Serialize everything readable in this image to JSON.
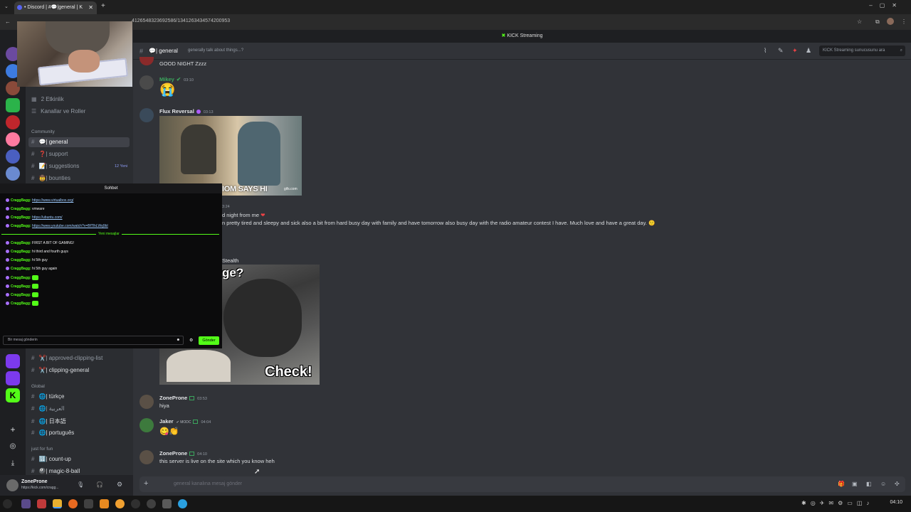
{
  "browser": {
    "tab_title": "• Discord | #💬|general | K",
    "url": "1412654832369258​6/1341263434574200953",
    "url_display": "…41265483236925​86/1341263434574200953"
  },
  "banner": {
    "text": "KICK Streaming"
  },
  "header": {
    "channel": "💬| general",
    "topic": "generally talk about things...?",
    "search_placeholder": "KICK Streaming sunucusunu ara"
  },
  "sidebar": {
    "events": "2 Etkinlik",
    "channels_roles": "Kanallar ve Roller",
    "category_community": "Community",
    "items": [
      {
        "label": "💬| general"
      },
      {
        "label": "❓| support"
      },
      {
        "label": "📝| suggestions",
        "badge": "12 Yeni"
      },
      {
        "label": "🤠| bounties"
      },
      {
        "label": "✂️| approved-clipping-list"
      },
      {
        "label": "✂️| clipping-general"
      }
    ],
    "category_global": "Global",
    "global_items": [
      {
        "label": "🌐| türkçe"
      },
      {
        "label": "🌐| العربية"
      },
      {
        "label": "🌐| 日本語"
      },
      {
        "label": "🌐| português"
      }
    ],
    "category_fun": "just for fun",
    "fun_items": [
      {
        "label": "🔢| count-up"
      },
      {
        "label": "🎱| magic-8-ball"
      }
    ]
  },
  "user_panel": {
    "name": "ZoneProne",
    "status": "https://kick.com/cragg..."
  },
  "overlay": {
    "title": "Sohbet",
    "new_messages": "Yeni mesajlar",
    "input_placeholder": "Bir mesaj gönderin",
    "send_label": "Gönder",
    "lines": [
      {
        "user": "CraggBagg:",
        "text": "https://www.virtualbox.org/",
        "link": true
      },
      {
        "user": "CraggBagg:",
        "text": "vmware",
        "link": false
      },
      {
        "user": "CraggBagg:",
        "text": "https://ubuntu.com/",
        "link": true
      },
      {
        "user": "CraggBagg:",
        "text": "https://www.youtube.com/watch?v=BfTlhLWq9bI",
        "link": true
      },
      {
        "user": "CraggBagg:",
        "text": "FIRST A BIT OF GAMING!",
        "link": false
      },
      {
        "user": "CraggBagg:",
        "text": "hi third and fourth guys",
        "link": false
      },
      {
        "user": "CraggBagg:",
        "text": "hi 5th guy",
        "link": false
      },
      {
        "user": "CraggBagg:",
        "text": "hi 5th guy again",
        "link": false
      },
      {
        "user": "CraggBagg:",
        "text": "",
        "link": false
      },
      {
        "user": "CraggBagg:",
        "text": "",
        "link": false
      },
      {
        "user": "CraggBagg:",
        "text": "",
        "link": false
      },
      {
        "user": "CraggBagg:",
        "text": "",
        "link": false
      }
    ]
  },
  "messages": {
    "m0": {
      "text": "GOOD NIGHT Zzzz"
    },
    "m1": {
      "user": "Mikey",
      "time": "03:10",
      "emoji": "😭"
    },
    "m2": {
      "user": "Flux Reversal",
      "time": "03:13",
      "gif_caption": "TOM SAYS HI",
      "gif_caption_visible": "IOM SAYS HI",
      "gif_source": "gifs.com"
    },
    "m3": {
      "time": "3:24",
      "line1": "d night from me",
      "line2": "n pretty tired and sleepy and sick also a bit from hard busy day with family and have tomorrow also busy day with the radio amateur contest I have. Much love and have a great day."
    },
    "m4": {
      "user": "Stealth",
      "img_top": "ge?",
      "img_bottom": "Check!"
    },
    "m5": {
      "user": "ZoneProne",
      "time": "03:53",
      "text": "hiya"
    },
    "m6": {
      "user": "Jaker",
      "tag": "MODC",
      "time": "04:04",
      "emoji": "😋👏"
    },
    "m7": {
      "user": "ZoneProne",
      "time": "04:10",
      "text": "this server is live on the site which you know heh"
    }
  },
  "composer": {
    "placeholder": "general kanalına mesaj gönder"
  },
  "taskbar": {
    "clock": "04:10"
  },
  "colors": {
    "kick_green": "#53fc18",
    "discord_bg": "#313338",
    "mikey": "#3ba55d"
  }
}
